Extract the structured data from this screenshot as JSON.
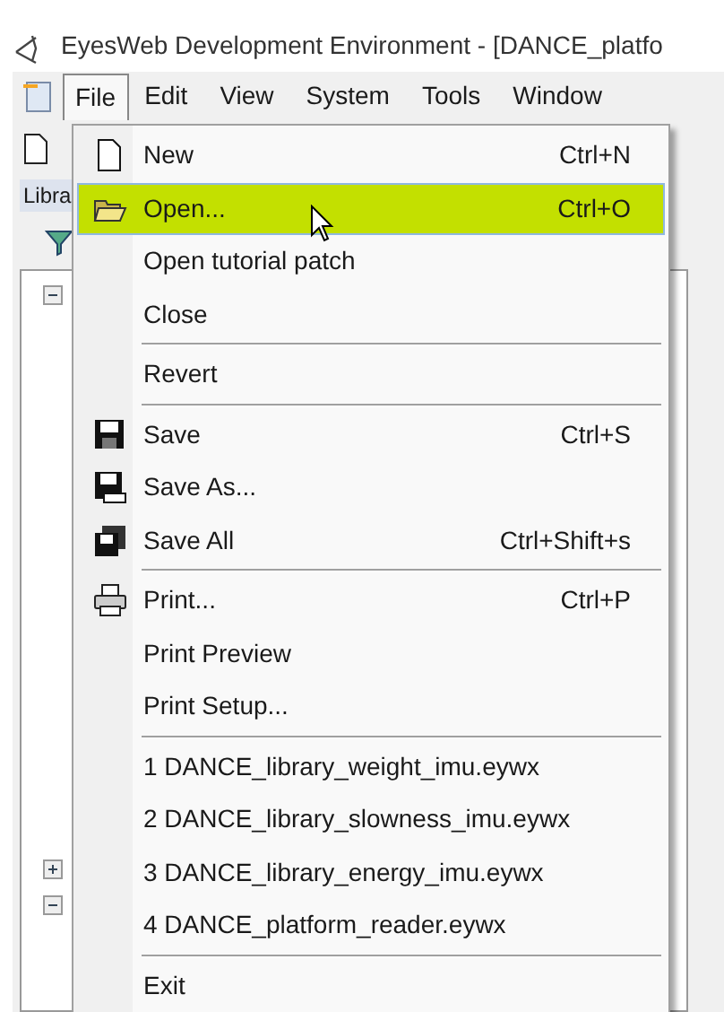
{
  "window": {
    "title": "EyesWeb Development Environment - [DANCE_platfo"
  },
  "menu_bar": [
    {
      "label": "File",
      "selected": true
    },
    {
      "label": "Edit",
      "selected": false
    },
    {
      "label": "View",
      "selected": false
    },
    {
      "label": "System",
      "selected": false
    },
    {
      "label": "Tools",
      "selected": false
    },
    {
      "label": "Window",
      "selected": false
    }
  ],
  "side_tab": {
    "label": "Libra"
  },
  "tree": [
    {
      "expanded": true
    },
    {
      "expanded": false
    },
    {
      "expanded": true
    }
  ],
  "file_menu": [
    {
      "kind": "item",
      "label": "New",
      "shortcut": "Ctrl+N",
      "selected": false
    },
    {
      "kind": "item",
      "label": "Open...",
      "shortcut": "Ctrl+O",
      "selected": true
    },
    {
      "kind": "item",
      "label": "Open tutorial patch",
      "selected": false
    },
    {
      "kind": "item",
      "label": "Close",
      "selected": false
    },
    {
      "kind": "separator"
    },
    {
      "kind": "item",
      "label": "Revert",
      "selected": false
    },
    {
      "kind": "separator"
    },
    {
      "kind": "item",
      "label": "Save",
      "shortcut": "Ctrl+S",
      "selected": false
    },
    {
      "kind": "item",
      "label": "Save As...",
      "selected": false
    },
    {
      "kind": "item",
      "label": "Save All",
      "shortcut": "Ctrl+Shift+s",
      "selected": false
    },
    {
      "kind": "separator"
    },
    {
      "kind": "item",
      "label": "Print...",
      "shortcut": "Ctrl+P",
      "selected": false
    },
    {
      "kind": "item",
      "label": "Print Preview",
      "selected": false
    },
    {
      "kind": "item",
      "label": "Print Setup...",
      "selected": false
    },
    {
      "kind": "separator"
    },
    {
      "kind": "item",
      "label": "1 DANCE_library_weight_imu.eywx",
      "selected": false
    },
    {
      "kind": "item",
      "label": "2 DANCE_library_slowness_imu.eywx",
      "selected": false
    },
    {
      "kind": "item",
      "label": "3 DANCE_library_energy_imu.eywx",
      "selected": false
    },
    {
      "kind": "item",
      "label": "4 DANCE_platform_reader.eywx",
      "selected": false
    },
    {
      "kind": "separator"
    },
    {
      "kind": "item",
      "label": "Exit",
      "selected": false
    }
  ]
}
